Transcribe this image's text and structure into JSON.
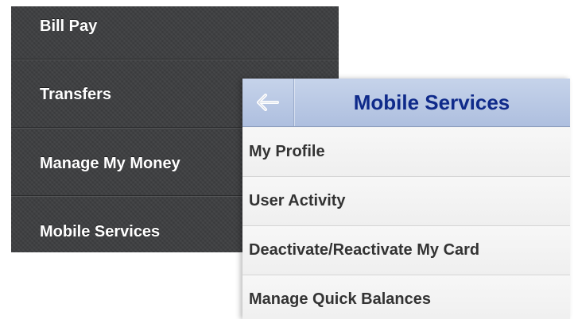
{
  "side_menu": {
    "items": [
      {
        "label": "Bill Pay"
      },
      {
        "label": "Transfers"
      },
      {
        "label": "Manage My Money"
      },
      {
        "label": "Mobile Services"
      }
    ]
  },
  "panel": {
    "title": "Mobile Services",
    "back_icon": "back-arrow-icon",
    "items": [
      {
        "label": "My Profile"
      },
      {
        "label": "User Activity"
      },
      {
        "label": "Deactivate/Reactivate My Card"
      },
      {
        "label": "Manage Quick Balances"
      }
    ]
  },
  "colors": {
    "menu_bg": "#3f4042",
    "header_title": "#0f2a8a",
    "header_bg": "#b9c8e5"
  }
}
